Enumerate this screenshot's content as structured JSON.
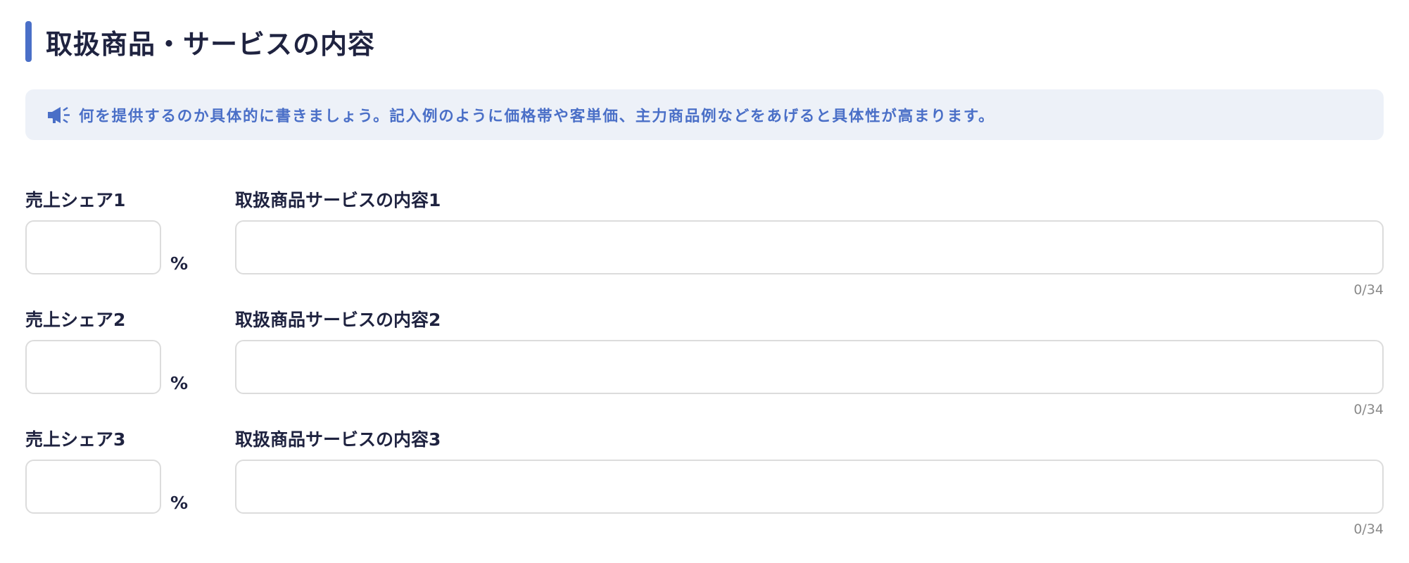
{
  "section": {
    "title": "取扱商品・サービスの内容"
  },
  "hint": {
    "icon": "megaphone-icon",
    "text": "何を提供するのか具体的に書きましょう。記入例のように価格帯や客単価、主力商品例などをあげると具体性が高まります。"
  },
  "colors": {
    "accent": "#4a6fc7",
    "hint_background": "#edf1f8",
    "text": "#1f2340",
    "border": "#dcdcdc",
    "counter": "#8a8a8a"
  },
  "rows": [
    {
      "share_label": "売上シェア1",
      "share_value": "",
      "unit": "%",
      "content_label": "取扱商品サービスの内容1",
      "content_value": "",
      "counter": "0/34"
    },
    {
      "share_label": "売上シェア2",
      "share_value": "",
      "unit": "%",
      "content_label": "取扱商品サービスの内容2",
      "content_value": "",
      "counter": "0/34"
    },
    {
      "share_label": "売上シェア3",
      "share_value": "",
      "unit": "%",
      "content_label": "取扱商品サービスの内容3",
      "content_value": "",
      "counter": "0/34"
    }
  ]
}
